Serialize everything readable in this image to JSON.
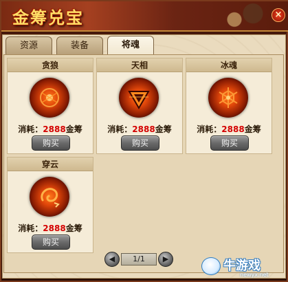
{
  "window": {
    "title": "金筹兑宝",
    "close_label": "×"
  },
  "tabs": [
    {
      "label": "资源",
      "active": false
    },
    {
      "label": "装备",
      "active": false
    },
    {
      "label": "将魂",
      "active": true
    }
  ],
  "items": [
    {
      "name": "贪狼",
      "cost_prefix": "消耗：",
      "cost": "2888",
      "currency": "金筹",
      "buy_label": "购买",
      "icon": "wolf-sigil-icon"
    },
    {
      "name": "天相",
      "cost_prefix": "消耗：",
      "cost": "2888",
      "currency": "金筹",
      "buy_label": "购买",
      "icon": "triangle-sigil-icon"
    },
    {
      "name": "冰魂",
      "cost_prefix": "消耗：",
      "cost": "2888",
      "currency": "金筹",
      "buy_label": "购买",
      "icon": "snowflake-sigil-icon"
    },
    {
      "name": "穿云",
      "cost_prefix": "消耗：",
      "cost": "2888",
      "currency": "金筹",
      "buy_label": "购买",
      "icon": "cloud-swirl-sigil-icon"
    }
  ],
  "pager": {
    "label": "1/1",
    "prev_icon": "arrow-left-icon",
    "next_icon": "arrow-right-icon"
  },
  "watermark": {
    "text": "牛游戏",
    "url": "newyx.net"
  },
  "colors": {
    "cost_number": "#d40000",
    "orb": "#e0460a",
    "title": "#ffde66"
  }
}
